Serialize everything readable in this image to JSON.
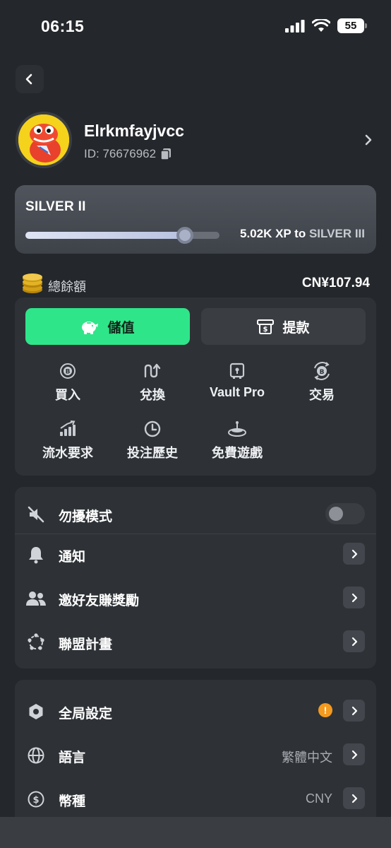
{
  "status_bar": {
    "time": "06:15",
    "battery": "55"
  },
  "profile": {
    "username": "Elrkmfayjvcc",
    "id_text": "ID: 76676962"
  },
  "rank": {
    "current": "SILVER II",
    "progress_fraction": 0.82,
    "xp_needed": "5.02K XP to",
    "next_rank": "SILVER III"
  },
  "balance": {
    "label": "總餘額",
    "value": "CN¥107.94"
  },
  "wallet": {
    "deposit_label": "儲值",
    "withdraw_label": "提款",
    "actions": [
      {
        "label": "買入",
        "icon": "bitcoin-buy-icon"
      },
      {
        "label": "兌換",
        "icon": "swap-icon"
      },
      {
        "label": "Vault Pro",
        "icon": "vault-icon"
      },
      {
        "label": "交易",
        "icon": "bitcoin-exchange-icon"
      },
      {
        "label": "流水要求",
        "icon": "chart-icon"
      },
      {
        "label": "投注歷史",
        "icon": "clock-icon"
      },
      {
        "label": "免費遊戲",
        "icon": "spinner-icon"
      }
    ]
  },
  "settings_group_1": [
    {
      "label": "勿擾模式",
      "icon": "mute-icon",
      "control": "toggle",
      "enabled": false
    },
    {
      "label": "通知",
      "icon": "bell-icon",
      "control": "chevron"
    },
    {
      "label": "邀好友賺獎勵",
      "icon": "users-icon",
      "control": "chevron"
    },
    {
      "label": "聯盟計畫",
      "icon": "network-icon",
      "control": "chevron"
    }
  ],
  "settings_group_2": [
    {
      "label": "全局設定",
      "icon": "settings-icon",
      "badge": "!",
      "control": "chevron"
    },
    {
      "label": "語言",
      "icon": "globe-icon",
      "value": "繁體中文",
      "control": "chevron"
    },
    {
      "label": "幣種",
      "icon": "dollar-icon",
      "value": "CNY",
      "control": "chevron"
    }
  ],
  "colors": {
    "background": "#24272b",
    "card": "#2e3236",
    "accent_green": "#2fe589",
    "warning_orange": "#f39a1f"
  }
}
